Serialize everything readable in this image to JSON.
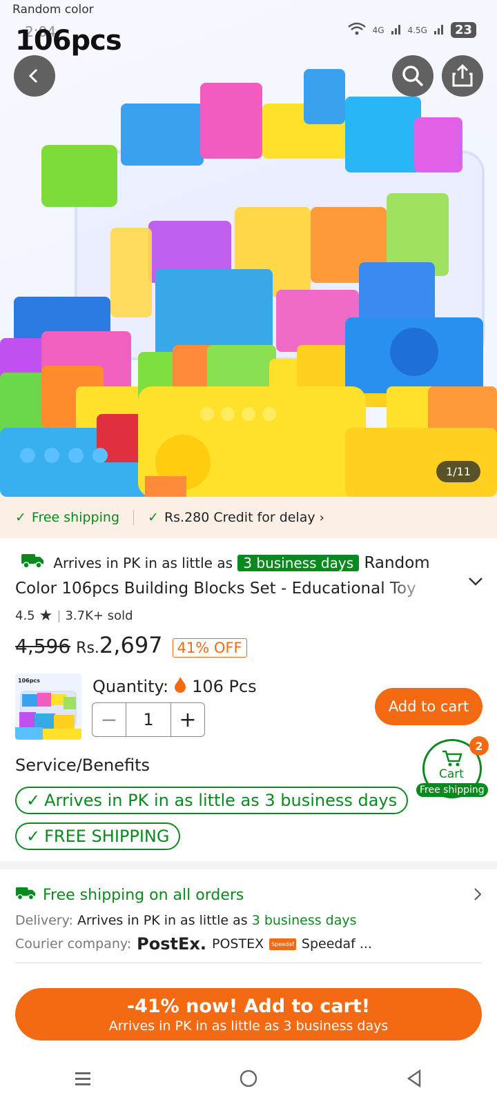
{
  "hero": {
    "overlay_caption": "Random color",
    "overlay_title": "106pcs",
    "status_time": "2:04",
    "status_net1": "4G",
    "status_net2": "4.5G",
    "battery": "23",
    "image_counter": "1/11"
  },
  "shipping_bar": {
    "free_shipping": "Free shipping",
    "credit": "Rs.280 Credit for delay"
  },
  "product": {
    "arrives_prefix": "Arrives in PK in as little as",
    "arrives_badge": "3 business days",
    "title_line1": "Random",
    "title_line2": "Color 106pcs Building Blocks Set - Educational Toy",
    "rating": "4.5",
    "sold": "3.7K+ sold",
    "old_price": "4,596",
    "currency": "Rs.",
    "price": "2,697",
    "discount": "41% OFF"
  },
  "purchase": {
    "thumb_caption": "106pcs",
    "quantity_label": "Quantity:",
    "quantity_option": "106 Pcs",
    "quantity_value": "1",
    "add_to_cart": "Add to cart"
  },
  "services": {
    "title": "Service/Benefits",
    "pill1": "Arrives in PK in as little as 3 business days",
    "pill2": "FREE SHIPPING"
  },
  "cart_float": {
    "count": "2",
    "label": "Cart",
    "tag": "Free shipping"
  },
  "shipping_info": {
    "headline": "Free shipping on all orders",
    "delivery_label": "Delivery:",
    "delivery_text": "Arrives in PK in as little as",
    "delivery_days": "3 business days",
    "courier_label": "Courier company:",
    "courier1_logo": "PostEx.",
    "courier1": "POSTEX",
    "courier2_logo": "Speedaf",
    "courier2": "Speedaf ..."
  },
  "cta": {
    "main": "-41% now! Add to cart!",
    "sub": "Arrives in PK in as little as 3 business days"
  },
  "colors": {
    "accent": "#f46a12",
    "green": "#0a8a1e"
  }
}
